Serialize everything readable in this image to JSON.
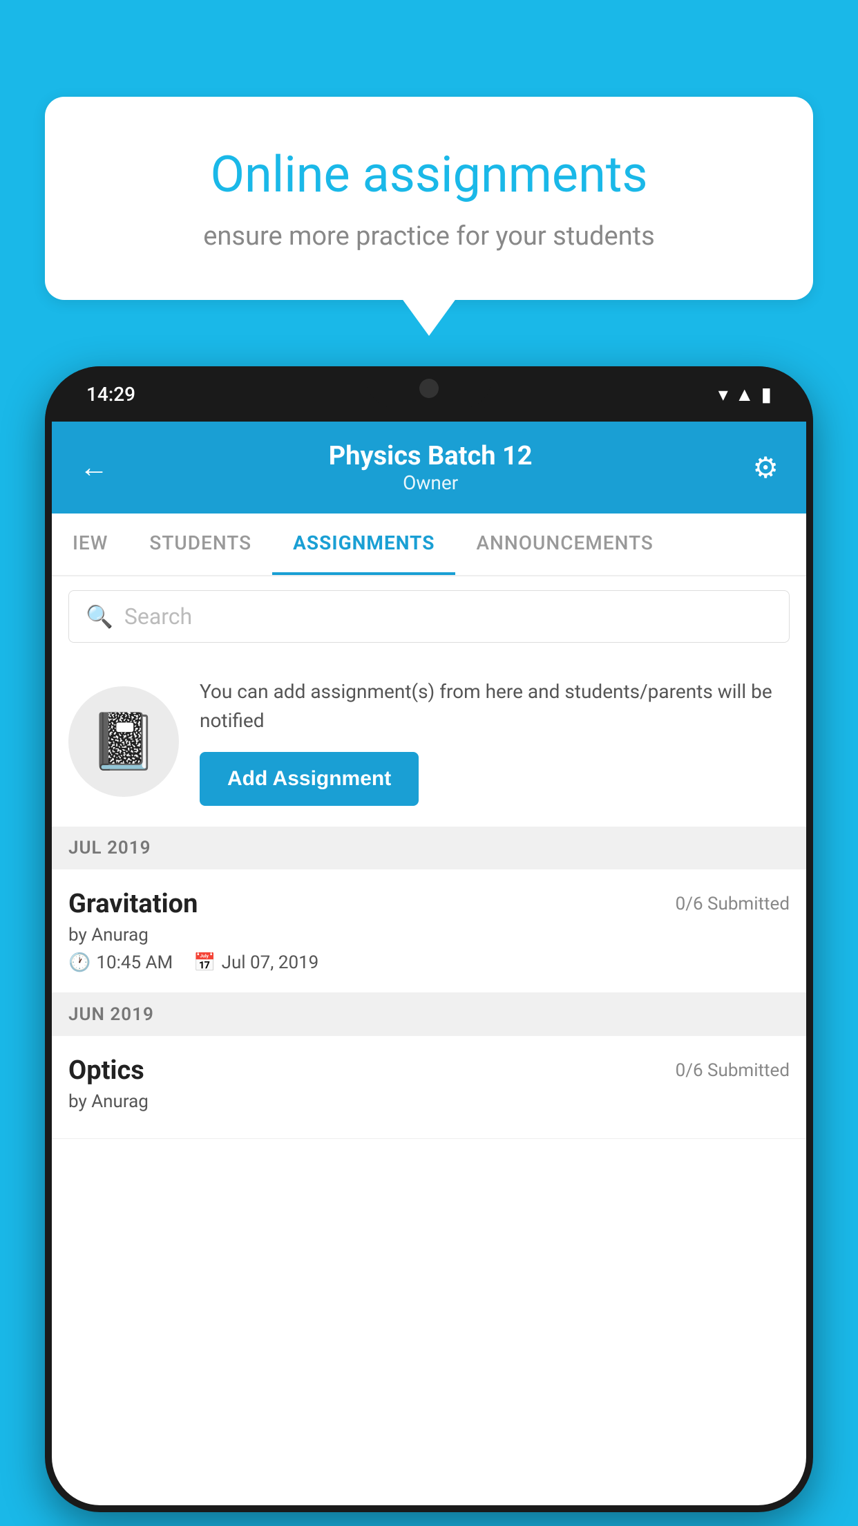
{
  "background_color": "#1ab8e8",
  "speech_bubble": {
    "title": "Online assignments",
    "subtitle": "ensure more practice for your students"
  },
  "phone": {
    "status_time": "14:29",
    "header": {
      "title": "Physics Batch 12",
      "subtitle": "Owner",
      "back_label": "←",
      "gear_label": "⚙"
    },
    "tabs": [
      {
        "label": "IEW",
        "active": false
      },
      {
        "label": "STUDENTS",
        "active": false
      },
      {
        "label": "ASSIGNMENTS",
        "active": true
      },
      {
        "label": "ANNOUNCEMENTS",
        "active": false
      }
    ],
    "search": {
      "placeholder": "Search"
    },
    "info_card": {
      "description": "You can add assignment(s) from here and students/parents will be notified",
      "button_label": "Add Assignment"
    },
    "sections": [
      {
        "header": "JUL 2019",
        "assignments": [
          {
            "name": "Gravitation",
            "submitted": "0/6 Submitted",
            "by": "by Anurag",
            "time": "10:45 AM",
            "date": "Jul 07, 2019"
          }
        ]
      },
      {
        "header": "JUN 2019",
        "assignments": [
          {
            "name": "Optics",
            "submitted": "0/6 Submitted",
            "by": "by Anurag",
            "time": "",
            "date": ""
          }
        ]
      }
    ]
  }
}
